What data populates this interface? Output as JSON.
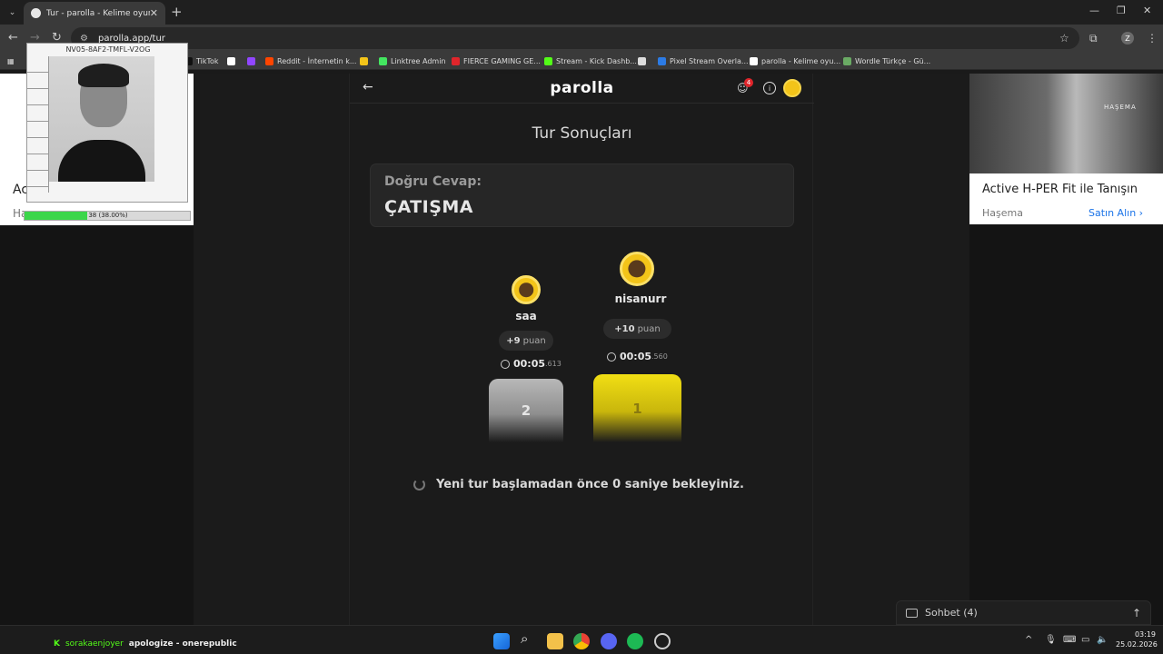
{
  "browser": {
    "tab_title": "Tur - parolla - Kelime oyunu",
    "url": "parolla.app/tur",
    "bookmarks": [
      {
        "label": "TikTok",
        "color": "#111111"
      },
      {
        "label": "",
        "color": "#ffffff",
        "icon": "x-logo-icon"
      },
      {
        "label": "",
        "color": "#9146ff",
        "icon": "twitch-icon"
      },
      {
        "label": "Reddit - İnternetin k...",
        "color": "#ff4500"
      },
      {
        "label": "",
        "color": "#f3c419",
        "icon": "snapchat-icon"
      },
      {
        "label": "Linktree Admin",
        "color": "#43e660"
      },
      {
        "label": "FIERCE GAMING GE...",
        "color": "#e0252b"
      },
      {
        "label": "Stream - Kick Dashb...",
        "color": "#53fc18"
      },
      {
        "label": "",
        "color": "#dddddd",
        "icon": "github-icon"
      },
      {
        "label": "Pixel Stream Overla...",
        "color": "#2c7be5"
      },
      {
        "label": "parolla - Kelime oyu...",
        "color": "#ffffff"
      },
      {
        "label": "Wordle Türkçe - Gü...",
        "color": "#6aaa64"
      }
    ]
  },
  "app": {
    "logo": "parolla",
    "online_count": "4",
    "round_title": "Tur Sonuçları",
    "answer_label": "Doğru Cevap:",
    "answer_word": "ÇATIŞMA",
    "wait_message": "Yeni tur başlamadan önce 0 saniye bekleyiniz.",
    "chat_label": "Sohbet (4)"
  },
  "players": {
    "first": {
      "name": "nisanurr",
      "points": "+10",
      "points_unit": "puan",
      "time_main": "00:05",
      "time_ms": ".560",
      "rank": "1"
    },
    "second": {
      "name": "saa",
      "points": "+9",
      "points_unit": "puan",
      "time_main": "00:05",
      "time_ms": ".613",
      "rank": "2"
    }
  },
  "ads": {
    "left": {
      "title": "Ac",
      "sub": "Ha"
    },
    "right": {
      "brand": "HAŞEMA",
      "title": "Active H-PER Fit ile Tanışın",
      "sub": "Haşema",
      "cta": "Satın Alın"
    }
  },
  "overlay": {
    "cam_id": "NV05-8AF2-TMFL-V2OG",
    "progress_label": "38 (38.00%)",
    "progress_fraction": 0.38
  },
  "taskbar": {
    "user": "sorakaenjoyer",
    "song": "apologize - onerepublic",
    "time": "03:19",
    "date": "25.02.2026"
  }
}
